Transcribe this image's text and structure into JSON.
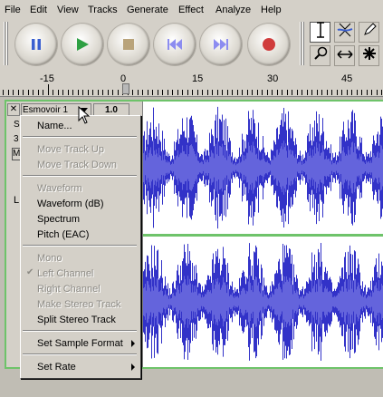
{
  "menubar": [
    "File",
    "Edit",
    "View",
    "Tracks",
    "Generate",
    "Effect",
    "Analyze",
    "Help"
  ],
  "colors": {
    "wave": "#3232c8",
    "wave_inner": "#6464dc",
    "selection": "#6ec36a"
  },
  "icons": {
    "pause": "pause-icon",
    "play": "play-icon",
    "stop": "stop-icon",
    "skip_start": "skip-to-start-icon",
    "skip_end": "skip-to-end-icon",
    "record": "record-icon",
    "select": "i-beam-icon",
    "envelope": "envelope-icon",
    "draw": "pencil-icon",
    "zoom": "magnifier-icon",
    "timeshift": "horizontal-arrows-icon",
    "multi": "asterisk-icon"
  },
  "ruler": {
    "labels": [
      "-15",
      "0",
      "15",
      "30",
      "45"
    ]
  },
  "track": {
    "close": "✕",
    "name": "Esmovoir 1",
    "gain": "1.0",
    "partial_labels": [
      "S",
      "3",
      "M",
      "L"
    ]
  },
  "dropdown": {
    "name": "Name...",
    "move_up": "Move Track Up",
    "move_down": "Move Track Down",
    "waveform": "Waveform",
    "waveform_db": "Waveform (dB)",
    "spectrum": "Spectrum",
    "pitch": "Pitch (EAC)",
    "mono": "Mono",
    "left": "Left Channel",
    "right": "Right Channel",
    "make_stereo": "Make Stereo Track",
    "split_stereo": "Split Stereo Track",
    "sample_format": "Set Sample Format",
    "set_rate": "Set Rate"
  }
}
